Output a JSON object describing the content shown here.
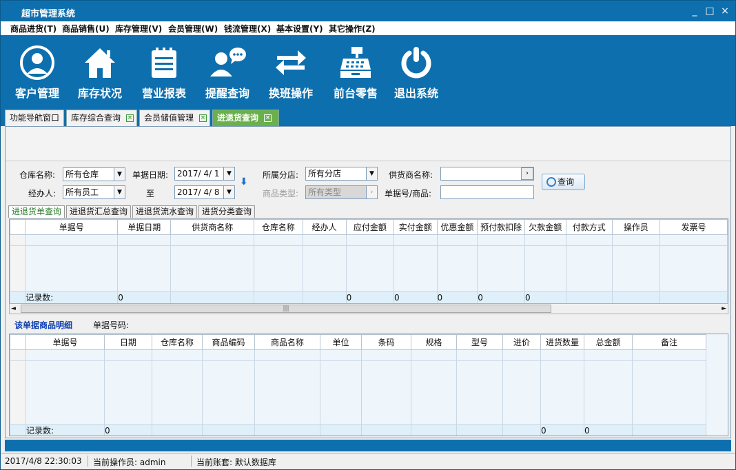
{
  "window": {
    "title": "超市管理系统",
    "controls": [
      "_",
      "□",
      "×"
    ]
  },
  "menu": [
    "商品进货(T)",
    "商品销售(U)",
    "库存管理(V)",
    "会员管理(W)",
    "钱流管理(X)",
    "基本设置(Y)",
    "其它操作(Z)"
  ],
  "toolbar": [
    {
      "label": "客户管理",
      "icon": "user-circle-icon"
    },
    {
      "label": "库存状况",
      "icon": "house-icon"
    },
    {
      "label": "营业报表",
      "icon": "report-list-icon"
    },
    {
      "label": "提醒查询",
      "icon": "user-chat-icon"
    },
    {
      "label": "换班操作",
      "icon": "swap-arrows-icon"
    },
    {
      "label": "前台零售",
      "icon": "cash-register-icon"
    },
    {
      "label": "退出系统",
      "icon": "power-icon"
    }
  ],
  "tabs": [
    {
      "label": "功能导航窗口"
    },
    {
      "label": "库存综合查询"
    },
    {
      "label": "会员储值管理"
    },
    {
      "label": "进退货查询"
    }
  ],
  "filters": {
    "warehouse_label": "仓库名称:",
    "warehouse_value": "所有仓库",
    "operator_label": "经办人:",
    "operator_value": "所有员工",
    "date_label": "单据日期:",
    "date_from": "2017/ 4/ 1",
    "to_label": "至",
    "date_to": "2017/ 4/ 8",
    "branch_label": "所属分店:",
    "branch_value": "所有分店",
    "category_label": "商品类型:",
    "category_value": "所有类型",
    "supplier_label": "供货商名称:",
    "supplier_value": "",
    "docno_label": "单据号/商品:",
    "docno_value": "",
    "query_button": "查询"
  },
  "subtabs": [
    "进退货单查询",
    "进退货汇总查询",
    "进退货流水查询",
    "进货分类查询"
  ],
  "grid1": {
    "columns": [
      "单据号",
      "单据日期",
      "供货商名称",
      "仓库名称",
      "经办人",
      "应付金额",
      "实付金额",
      "优惠金额",
      "预付款扣除",
      "欠款金额",
      "付款方式",
      "操作员",
      "发票号"
    ],
    "summary": {
      "label": "记录数:",
      "count": "0",
      "payable": "0",
      "paid": "0",
      "discount": "0",
      "prepay": "0",
      "debt": "0"
    }
  },
  "detail": {
    "title": "该单据商品明细",
    "docno_label": "单据号码:",
    "docno_value": ""
  },
  "grid2": {
    "columns": [
      "单据号",
      "日期",
      "仓库名称",
      "商品编码",
      "商品名称",
      "单位",
      "条码",
      "规格",
      "型号",
      "进价",
      "进货数量",
      "总金额",
      "备注"
    ],
    "summary": {
      "label": "记录数:",
      "count": "0",
      "qty": "0",
      "total": "0"
    }
  },
  "status": {
    "datetime": "2017/4/8 22:30:03",
    "operator": "当前操作员: admin",
    "account": "当前账套: 默认数据库"
  },
  "colors": {
    "primary": "#0e6fae",
    "active_tab": "#6ab04c"
  }
}
